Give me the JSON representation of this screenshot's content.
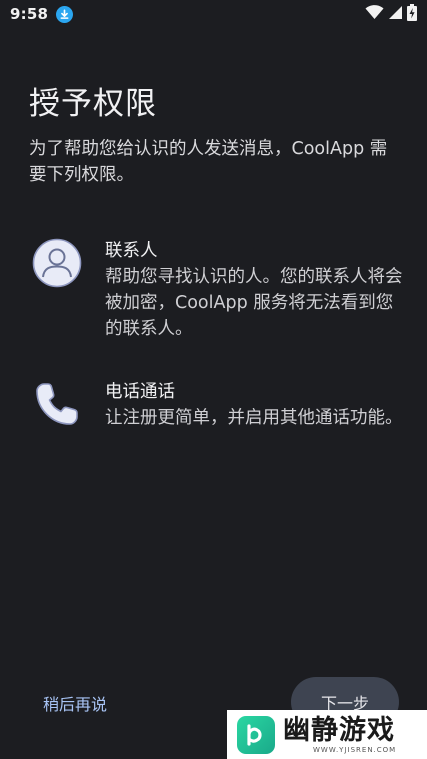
{
  "status_bar": {
    "time": "9:58",
    "icons": [
      "download-icon",
      "wifi-icon",
      "signal-icon",
      "battery-charging-icon"
    ]
  },
  "page": {
    "title": "授予权限",
    "intro": "为了帮助您给认识的人发送消息，CoolApp 需要下列权限。"
  },
  "permissions": [
    {
      "icon": "contact-avatar-icon",
      "title": "联系人",
      "description": "帮助您寻找认识的人。您的联系人将会被加密，CoolApp 服务将无法看到您的联系人。"
    },
    {
      "icon": "phone-icon",
      "title": "电话通话",
      "description": "让注册更简单，并启用其他通话功能。"
    }
  ],
  "actions": {
    "later_label": "稍后再说",
    "next_label": "下一步"
  },
  "watermark": {
    "title": "幽静游戏",
    "subtitle": "WWW.YJISREN.COM"
  },
  "colors": {
    "background": "#1c1d21",
    "accent_link": "#a8c4f5",
    "button_bg": "#3e4451",
    "icon_fill": "#c9cff0"
  }
}
